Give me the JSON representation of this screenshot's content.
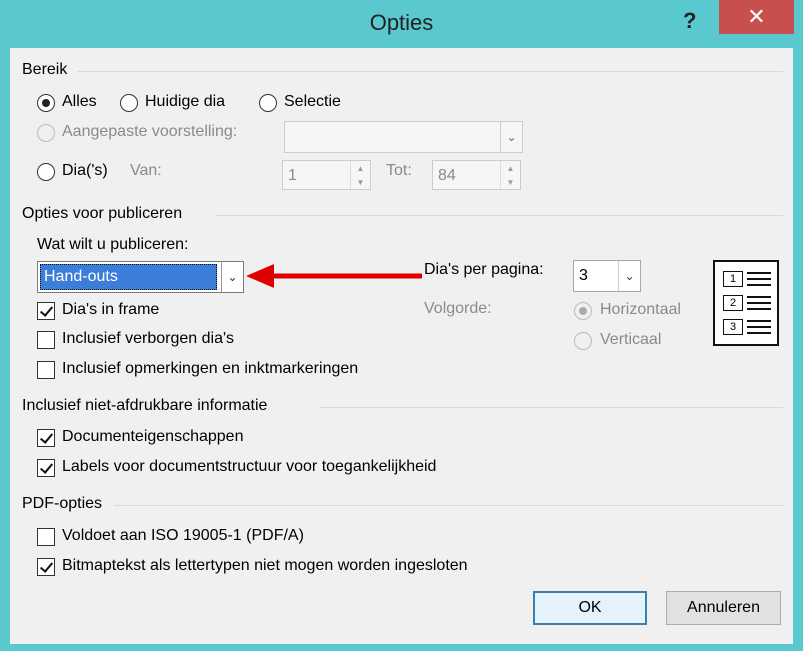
{
  "window": {
    "title": "Opties",
    "help": "?",
    "close": "✕"
  },
  "bereik": {
    "heading": "Bereik",
    "alles": "Alles",
    "huidige": "Huidige dia",
    "selectie": "Selectie",
    "aangepast": "Aangepaste voorstelling:",
    "dias": "Dia('s)",
    "van_label": "Van:",
    "van_value": "1",
    "tot_label": "Tot:",
    "tot_value": "84"
  },
  "publiceren": {
    "heading": "Opties voor publiceren",
    "wat_label": "Wat wilt u publiceren:",
    "wat_value": "Hand-outs",
    "dias_frame": "Dia's in frame",
    "verborgen": "Inclusief verborgen dia's",
    "opmerkingen": "Inclusief opmerkingen en inktmarkeringen",
    "per_pagina_label": "Dia's per pagina:",
    "per_pagina_value": "3",
    "volgorde_label": "Volgorde:",
    "horizontaal": "Horizontaal",
    "verticaal": "Verticaal",
    "preview_numbers": [
      "1",
      "2",
      "3"
    ]
  },
  "niet_afdrukbaar": {
    "heading": "Inclusief niet-afdrukbare informatie",
    "doc_eigenschappen": "Documenteigenschappen",
    "labels": "Labels voor documentstructuur voor toegankelijkheid"
  },
  "pdf": {
    "heading": "PDF-opties",
    "iso": "Voldoet aan ISO 19005-1 (PDF/A)",
    "bitmap": "Bitmaptekst als lettertypen niet mogen worden ingesloten"
  },
  "buttons": {
    "ok": "OK",
    "annuleren": "Annuleren"
  },
  "colors": {
    "titlebar": "#59c8cf",
    "close": "#c7504f",
    "highlight": "#3b7dd8",
    "arrow": "#e00000"
  }
}
